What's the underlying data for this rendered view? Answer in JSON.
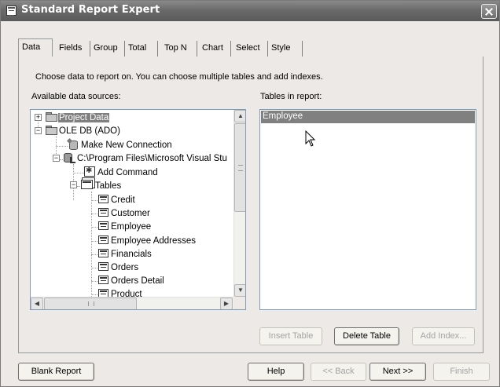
{
  "window": {
    "title": "Standard Report Expert"
  },
  "tabs": [
    "Data",
    "Fields",
    "Group",
    "Total",
    "Top N",
    "Chart",
    "Select",
    "Style"
  ],
  "active_tab": "Data",
  "instruction": "Choose data to report on. You can choose multiple tables and add indexes.",
  "available_label": "Available data sources:",
  "tables_label": "Tables in report:",
  "tree": {
    "project_data": "Project Data",
    "ole_db": "OLE DB (ADO)",
    "make_new_connection": "Make New Connection",
    "connection_path": "C:\\Program Files\\Microsoft Visual Stu",
    "add_command": "Add Command",
    "tables": "Tables",
    "table_items": [
      "Credit",
      "Customer",
      "Employee",
      "Employee Addresses",
      "Financials",
      "Orders",
      "Orders Detail",
      "Product"
    ]
  },
  "tables_in_report": [
    "Employee"
  ],
  "buttons": {
    "insert_table": "Insert Table",
    "delete_table": "Delete Table",
    "add_index": "Add Index...",
    "blank_report": "Blank Report",
    "help": "Help",
    "back": "<< Back",
    "next": "Next >>",
    "finish": "Finish"
  }
}
